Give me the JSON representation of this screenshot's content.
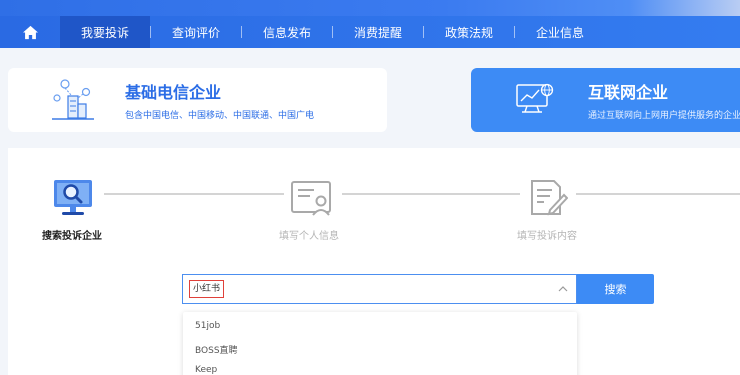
{
  "nav": {
    "home_icon": "home-icon",
    "items": [
      {
        "label": "我要投诉",
        "active": true
      },
      {
        "label": "查询评价",
        "active": false
      },
      {
        "label": "信息发布",
        "active": false
      },
      {
        "label": "消费提醒",
        "active": false
      },
      {
        "label": "政策法规",
        "active": false
      },
      {
        "label": "企业信息",
        "active": false
      }
    ]
  },
  "cards": {
    "basic": {
      "title": "基础电信企业",
      "subtitle": "包含中国电信、中国移动、中国联通、中国广电",
      "icon": "building-network-icon"
    },
    "internet": {
      "title": "互联网企业",
      "subtitle": "通过互联网向上网用户提供服务的企业",
      "icon": "monitor-globe-icon"
    }
  },
  "steps": [
    {
      "label": "搜索投诉企业",
      "active": true,
      "icon": "monitor-search-icon"
    },
    {
      "label": "填写个人信息",
      "active": false,
      "icon": "id-card-icon"
    },
    {
      "label": "填写投诉内容",
      "active": false,
      "icon": "document-edit-icon"
    }
  ],
  "search": {
    "value": "小红书",
    "button_label": "搜索"
  },
  "dropdown": {
    "options": [
      "51job",
      "BOSS直聘",
      "Keep"
    ]
  },
  "colors": {
    "primary": "#3d8bf5",
    "nav_active": "#1f56c8",
    "highlight_border": "#e0413a"
  }
}
